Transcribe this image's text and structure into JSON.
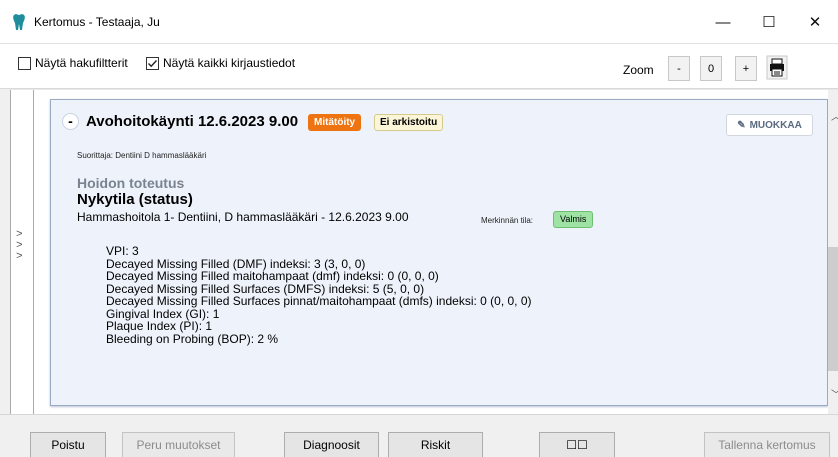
{
  "window": {
    "title": "Kertomus - Testaaja, Ju",
    "minimize_glyph": "—",
    "maximize_glyph": "☐",
    "close_glyph": "✕"
  },
  "toolbar": {
    "show_filters_label": "Näytä hakufiltterit",
    "show_filters_checked": false,
    "show_all_label": "Näytä kaikki kirjaustiedot",
    "show_all_checked": true,
    "zoom_label": "Zoom",
    "zoom_minus": "-",
    "zoom_value": "0",
    "zoom_plus": "+",
    "print_icon": "printer-icon"
  },
  "side": {
    "arrows": ">\n>\n>"
  },
  "entry": {
    "collapse_glyph": "-",
    "title": "Avohoitokäynti 12.6.2023 9.00",
    "badge_cancelled": "Mitätöity",
    "badge_archive": "Ei arkistoitu",
    "edit_button": "MUOKKAA",
    "performer": "Suorittaja: Dentiini D hammaslääkäri",
    "section_title": "Hoidon toteutus",
    "sub_title": "Nykytila (status)",
    "unit_line": "Hammashoitola 1- Dentiini, D hammaslääkäri - 12.6.2023 9.00",
    "state_label": "Merkinnän tila:",
    "state_value": "Valmis",
    "fields": [
      "VPI: 3",
      "Decayed Missing Filled (DMF) indeksi: 3 (3, 0, 0)",
      "Decayed Missing Filled maitohampaat (dmf) indeksi: 0 (0, 0, 0)",
      "Decayed Missing Filled Surfaces (DMFS) indeksi: 5 (5, 0, 0)",
      "Decayed Missing Filled Surfaces pinnat/maitohampaat (dmfs) indeksi: 0 (0, 0, 0)",
      "Gingival Index (GI): 1",
      "Plaque Index (PI): 1",
      "Bleeding on Probing (BOP): 2 %"
    ]
  },
  "colors": {
    "cancel_badge": "#ee7411",
    "archive_badge": "#fbf6d8",
    "state_badge": "#9fe3a4",
    "entry_bg": "#eef3fb"
  },
  "buttons": {
    "delete": "Poistu",
    "undo": "Peru muutokset",
    "diagnoses": "Diagnoosit",
    "risks": "Riskit",
    "layout": "☐☐",
    "save": "Tallenna kertomus"
  }
}
